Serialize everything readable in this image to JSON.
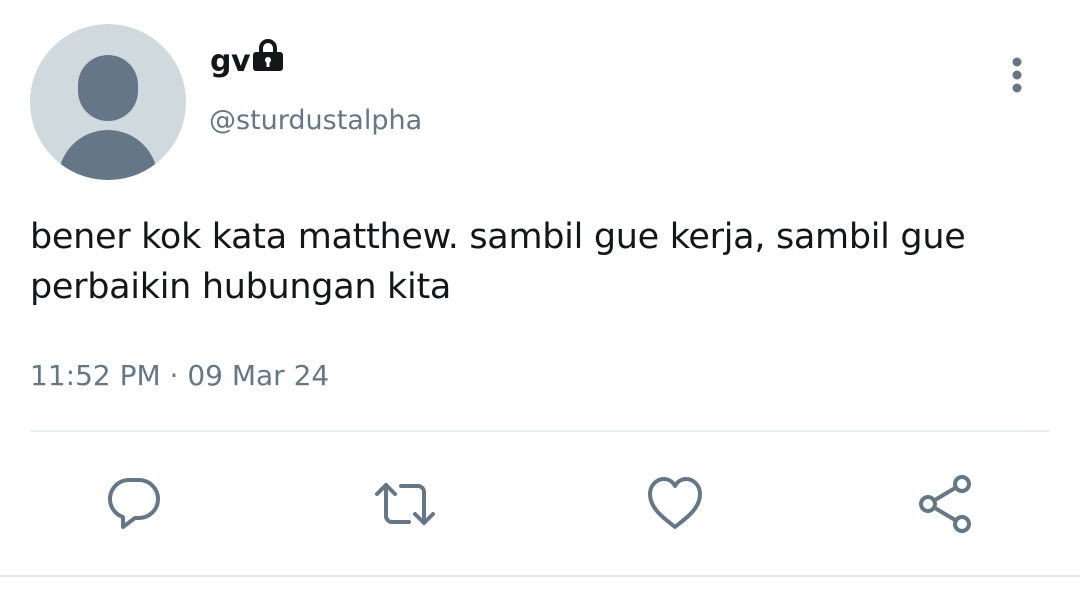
{
  "tweet": {
    "display_name": "gv",
    "handle": "@sturdustalpha",
    "text": "bener kok kata matthew. sambil gue kerja, sambil gue perbaikin hubungan kita",
    "timestamp": "11:52 PM · 09 Mar 24",
    "protected": true
  },
  "icons": {
    "avatar": "default-avatar",
    "lock": "lock-icon",
    "more": "more-vertical-icon",
    "reply": "reply-icon",
    "retweet": "retweet-icon",
    "like": "heart-icon",
    "share": "share-icon"
  },
  "colors": {
    "text": "#14171a",
    "secondary": "#657786",
    "avatar_bg": "#cfd9de",
    "divider": "#e6ecf0"
  }
}
